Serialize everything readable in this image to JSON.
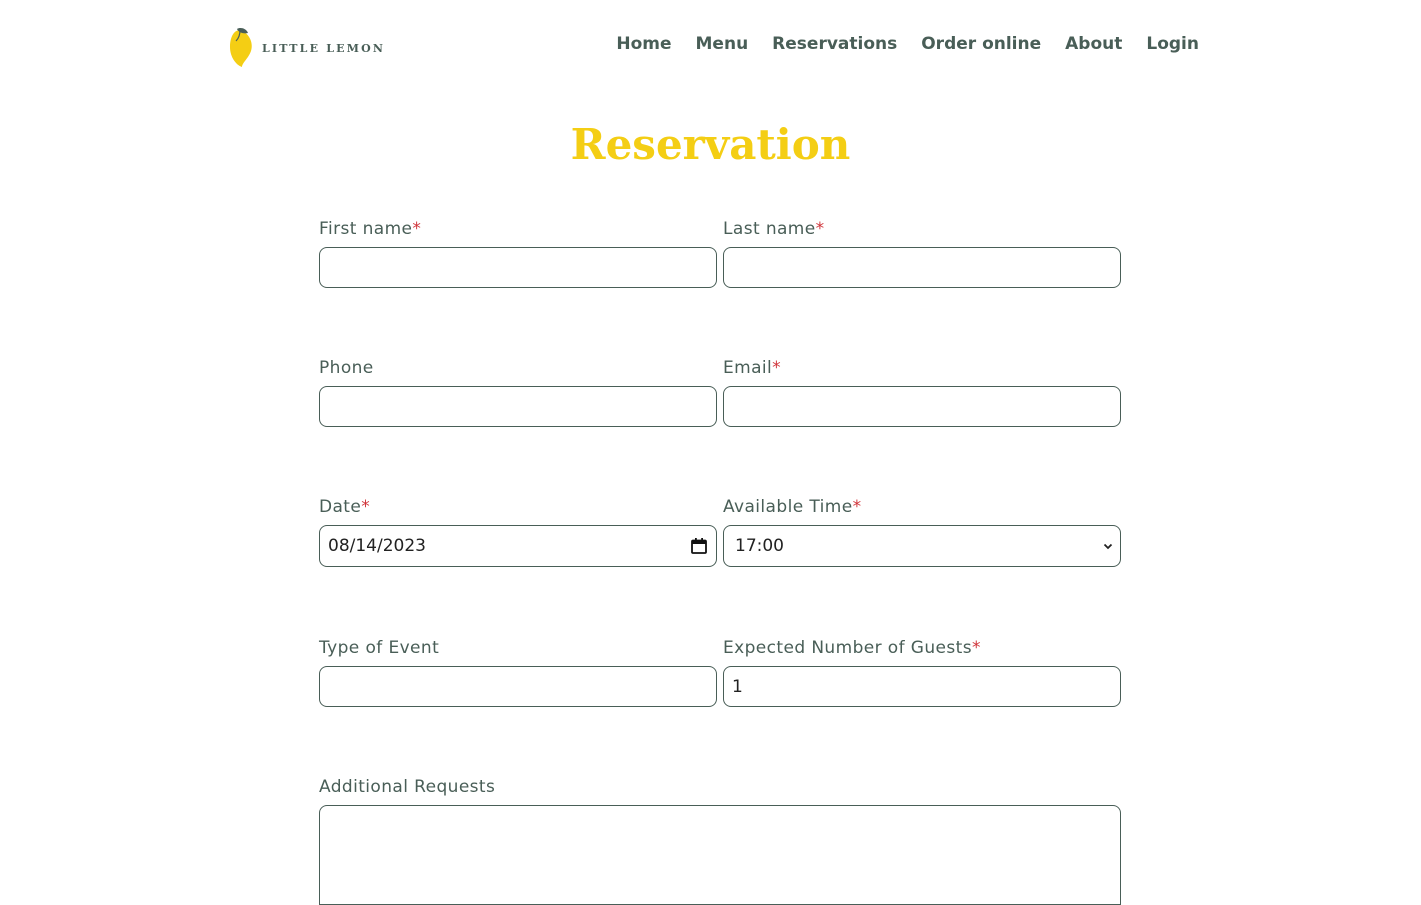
{
  "brand": {
    "name": "LITTLE LEMON",
    "accent_color": "#f4ce14",
    "text_color": "#495e57",
    "icon": "lemon-logo-icon"
  },
  "nav": {
    "items": [
      "Home",
      "Menu",
      "Reservations",
      "Order online",
      "About",
      "Login"
    ]
  },
  "page": {
    "title": "Reservation"
  },
  "form": {
    "first_name": {
      "label": "First name",
      "required": "*",
      "value": ""
    },
    "last_name": {
      "label": "Last name",
      "required": "*",
      "value": ""
    },
    "phone": {
      "label": "Phone",
      "value": ""
    },
    "email": {
      "label": "Email",
      "required": "*",
      "value": ""
    },
    "date": {
      "label": "Date",
      "required": "*",
      "value": "08/14/2023",
      "icon": "calendar-icon"
    },
    "time": {
      "label": "Available Time",
      "required": "*",
      "value": "17:00",
      "icon": "chevron-down-icon"
    },
    "event_type": {
      "label": "Type of Event",
      "value": ""
    },
    "guests": {
      "label": "Expected Number of Guests",
      "required": "*",
      "value": "1"
    },
    "requests": {
      "label": "Additional Requests",
      "value": ""
    }
  }
}
